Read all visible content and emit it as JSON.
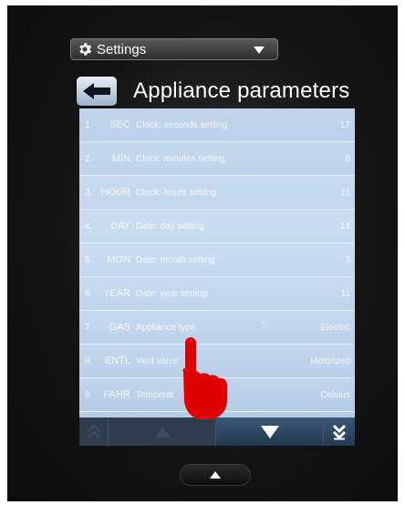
{
  "header": {
    "dropdown_label": "Settings",
    "title": "Appliance parameters"
  },
  "parameters": [
    {
      "index": "1.",
      "code": "SEC",
      "description": "Clock: seconds setting",
      "value": "17"
    },
    {
      "index": "2.",
      "code": "MIN",
      "description": "Clock: minutes setting",
      "value": "8"
    },
    {
      "index": "3.",
      "code": "HOUR",
      "description": "Clock: hours setting",
      "value": "11"
    },
    {
      "index": "4.",
      "code": "DAY",
      "description": "Date: day setting",
      "value": "14"
    },
    {
      "index": "5.",
      "code": "MON",
      "description": "Date: month setting",
      "value": "3"
    },
    {
      "index": "6.",
      "code": "YEAR",
      "description": "Date: year setting",
      "value": "11"
    },
    {
      "index": "7.",
      "code": "GAS",
      "description": "Appliance type",
      "value": "Electric"
    },
    {
      "index": "8.",
      "code": "ENTL",
      "description": "Vent valve",
      "value": "Motorized"
    },
    {
      "index": "9.",
      "code": "FAHR",
      "description": "Temperat",
      "value": "Celsius"
    }
  ],
  "icons": {
    "gear": "gear-icon",
    "back": "back-arrow-icon",
    "dropdown": "chevron-down-icon",
    "scroll_top": "double-chevron-up-icon",
    "scroll_up": "triangle-up-icon",
    "scroll_down": "triangle-down-icon",
    "scroll_bottom": "double-chevron-down-icon",
    "home": "triangle-up-icon",
    "pointer": "hand-pointer-icon"
  },
  "colors": {
    "list_background": "#bdd3eb",
    "scroll_bar": "#232c38",
    "pointer": "#e00000"
  }
}
